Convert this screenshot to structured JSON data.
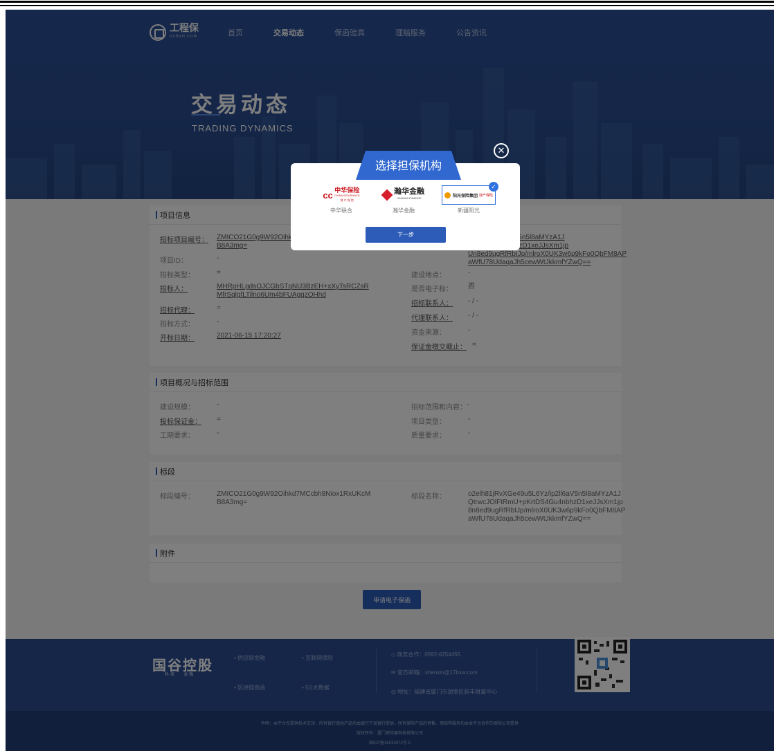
{
  "header": {
    "logo_text": "工程保",
    "logo_sub": "GCBXH.COM",
    "nav": [
      "首页",
      "交易动态",
      "保函验真",
      "理赔服务",
      "公告资讯"
    ],
    "active_nav": "交易动态"
  },
  "hero": {
    "title": "交易动态",
    "subtitle": "TRADING DYNAMICS"
  },
  "project_info": {
    "title": "项目信息",
    "left": [
      {
        "label": "招标项目编号：",
        "value": "ZMICO21G0g9W92Oihkd\nB8A3mg="
      },
      {
        "label": "项目ID：",
        "value": "-"
      },
      {
        "label": "招标类型：",
        "value": "="
      },
      {
        "label": "招标人：",
        "value": "MHRpHLgdsOJCGbSTqNU3BzEH+xXyTsRCZsR\nMfrSqlgfLTilno6Um4bFUAgqzOHhd"
      },
      {
        "label": "招标代理：",
        "value": "="
      },
      {
        "label": "招标方式：",
        "value": "-"
      },
      {
        "label": "开标日期：",
        "value": "2021-06-15 17:20:27"
      }
    ],
    "right_top": "u5L6Yz/ip2ll6aV5n5l8aMYzA1J\npKrtDS4Gu4nbhzD1xeJJsXm1jp\nUn8ed9ugRfRbIJp/mlroX0UK3w6p9kFo0QbFM8AP\naWfU78UdaqaJh5cewWtJkkmfYZwQ==",
    "right": [
      {
        "label": "建设地点：",
        "value": "-"
      },
      {
        "label": "是否电子标：",
        "value": "否"
      },
      {
        "label": "招标联系人：",
        "value": "- / -"
      },
      {
        "label": "代理联系人：",
        "value": "- / -"
      },
      {
        "label": "资金来源：",
        "value": "-"
      },
      {
        "label": "保证金缴交截止：",
        "value": "="
      }
    ]
  },
  "overview": {
    "title": "项目概况与招标范围",
    "left": [
      {
        "label": "建设规模：",
        "value": "-"
      },
      {
        "label": "投标保证金：",
        "value": "="
      },
      {
        "label": "工期要求：",
        "value": "-"
      }
    ],
    "right": [
      {
        "label": "招标范围和内容：",
        "value": "-"
      },
      {
        "label": "项目类型：",
        "value": "-"
      },
      {
        "label": "质量要求：",
        "value": "-"
      }
    ]
  },
  "section": {
    "title": "标段",
    "code_label": "标段编号：",
    "code_value": "ZMICO21G0g9W92Oihkd7MCcbh8Niox1RxUKcM\nB8A3mg=",
    "name_label": "标段名称：",
    "name_value": "o2elh81jRvXGe49u5L6Yz/ip2ll6aV5n5l8aMYzA1J\nQtrwcJOlFtRmU+pKrtDS4Gu4nbhzD1xeJJsXm1jp\n8n8ed9ugRfRbIJp/mlroX0UK3w6p9kFo0QbFM8AP\naWfU78UdaqaJh5cewWtJkkmfYZwQ=="
  },
  "attachments": {
    "title": "附件"
  },
  "apply_button": "申请电子保函",
  "dialog": {
    "title": "选择担保机构",
    "close_icon": "close-icon",
    "next_button": "下一步",
    "insurers": [
      {
        "logo_main": "中华保险",
        "logo_sub": "CHINA INSURANCE",
        "logo_tag": "财 产 保 险",
        "name": "中华联合",
        "color": "#c8161d",
        "selected": false
      },
      {
        "logo_main": "瀚华金融",
        "logo_sub": "HANHUA FINANCE",
        "name": "瀚华金融",
        "color": "#d51f2c",
        "selected": false
      },
      {
        "logo_main": "阳光保险集团",
        "logo_tag": "财产保险",
        "name": "新疆阳光",
        "color": "#f19a00",
        "selected": true
      }
    ]
  },
  "footer": {
    "brand": "国谷控股",
    "brand_sub": "科技 · 金融",
    "links": [
      "供应链金融",
      "互联网保险",
      "区块链保函",
      "5G大数据"
    ],
    "contacts": [
      "商务合作：0592-6254455",
      "官方邮箱：shenxin@17bxw.com",
      "地址：福建省厦门市湖里区蔚丰财富中心"
    ],
    "disclaimer": "声明：本平台仅提供技术支持，所有银行保函产品均由银行下发银行提供，所有保险产品的销售、理赔等服务均由本平台合作的保险公司提供",
    "copyright": "版权所有：厦门保险屋科技有限公司",
    "icp": "闽ICP备16034972号-5"
  },
  "colors": {
    "primary": "#2d5cb8",
    "hero": "#2b4f95",
    "footer": "#2a4d92"
  }
}
